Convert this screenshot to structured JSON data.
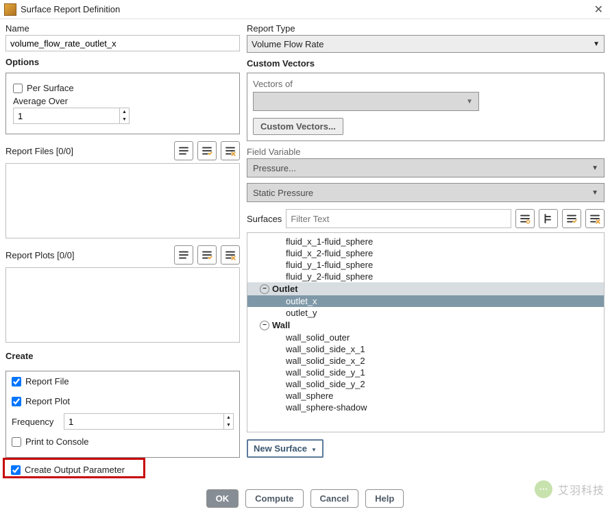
{
  "titlebar": {
    "title": "Surface Report Definition"
  },
  "name": {
    "label": "Name",
    "value": "volume_flow_rate_outlet_x"
  },
  "options": {
    "title": "Options",
    "per_surface": "Per Surface",
    "avg_over": "Average Over",
    "avg_val": "1"
  },
  "report_files": {
    "header": "Report Files [0/0]"
  },
  "report_plots": {
    "header": "Report Plots [0/0]"
  },
  "create": {
    "title": "Create",
    "report_file": "Report File",
    "report_plot": "Report Plot",
    "freq_label": "Frequency",
    "freq_val": "1",
    "print_console": "Print to Console",
    "create_out": "Create Output Parameter"
  },
  "report_type": {
    "label": "Report Type",
    "value": "Volume Flow Rate"
  },
  "custom_vectors": {
    "title": "Custom Vectors",
    "vectors_of": "Vectors of",
    "btn": "Custom Vectors..."
  },
  "field_var": {
    "label": "Field Variable",
    "v1": "Pressure...",
    "v2": "Static Pressure"
  },
  "surfaces": {
    "label": "Surfaces",
    "placeholder": "Filter Text",
    "items_top": [
      "fluid_x_1-fluid_sphere",
      "fluid_x_2-fluid_sphere",
      "fluid_y_1-fluid_sphere",
      "fluid_y_2-fluid_sphere"
    ],
    "grp_outlet": "Outlet",
    "outlet_items": [
      "outlet_x",
      "outlet_y"
    ],
    "grp_wall": "Wall",
    "wall_items": [
      "wall_solid_outer",
      "wall_solid_side_x_1",
      "wall_solid_side_x_2",
      "wall_solid_side_y_1",
      "wall_solid_side_y_2",
      "wall_sphere",
      "wall_sphere-shadow"
    ]
  },
  "newsurf": "New Surface",
  "buttons": {
    "ok": "OK",
    "compute": "Compute",
    "cancel": "Cancel",
    "help": "Help"
  },
  "watermark": "艾羽科技"
}
